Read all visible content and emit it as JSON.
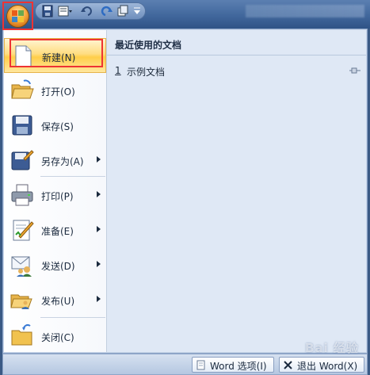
{
  "menu": {
    "items": [
      {
        "label": "新建(N)",
        "icon": "new-document-icon"
      },
      {
        "label": "打开(O)",
        "icon": "open-folder-icon"
      },
      {
        "label": "保存(S)",
        "icon": "save-floppy-icon"
      },
      {
        "label": "另存为(A)",
        "icon": "save-as-icon"
      },
      {
        "label": "打印(P)",
        "icon": "printer-icon"
      },
      {
        "label": "准备(E)",
        "icon": "prepare-document-icon"
      },
      {
        "label": "发送(D)",
        "icon": "send-icon"
      },
      {
        "label": "发布(U)",
        "icon": "publish-icon"
      },
      {
        "label": "关闭(C)",
        "icon": "close-folder-icon"
      }
    ]
  },
  "recent": {
    "title": "最近使用的文档",
    "items": [
      {
        "number": "1",
        "name": "示例文档"
      }
    ]
  },
  "bottom": {
    "options_label": "Word 选项(I)",
    "exit_label": "退出 Word(X)"
  },
  "watermark": "Bai 经验",
  "colors": {
    "highlight_red": "#e33333",
    "selected_item": "#ffd866",
    "menu_bg": "#dfe8f5"
  }
}
